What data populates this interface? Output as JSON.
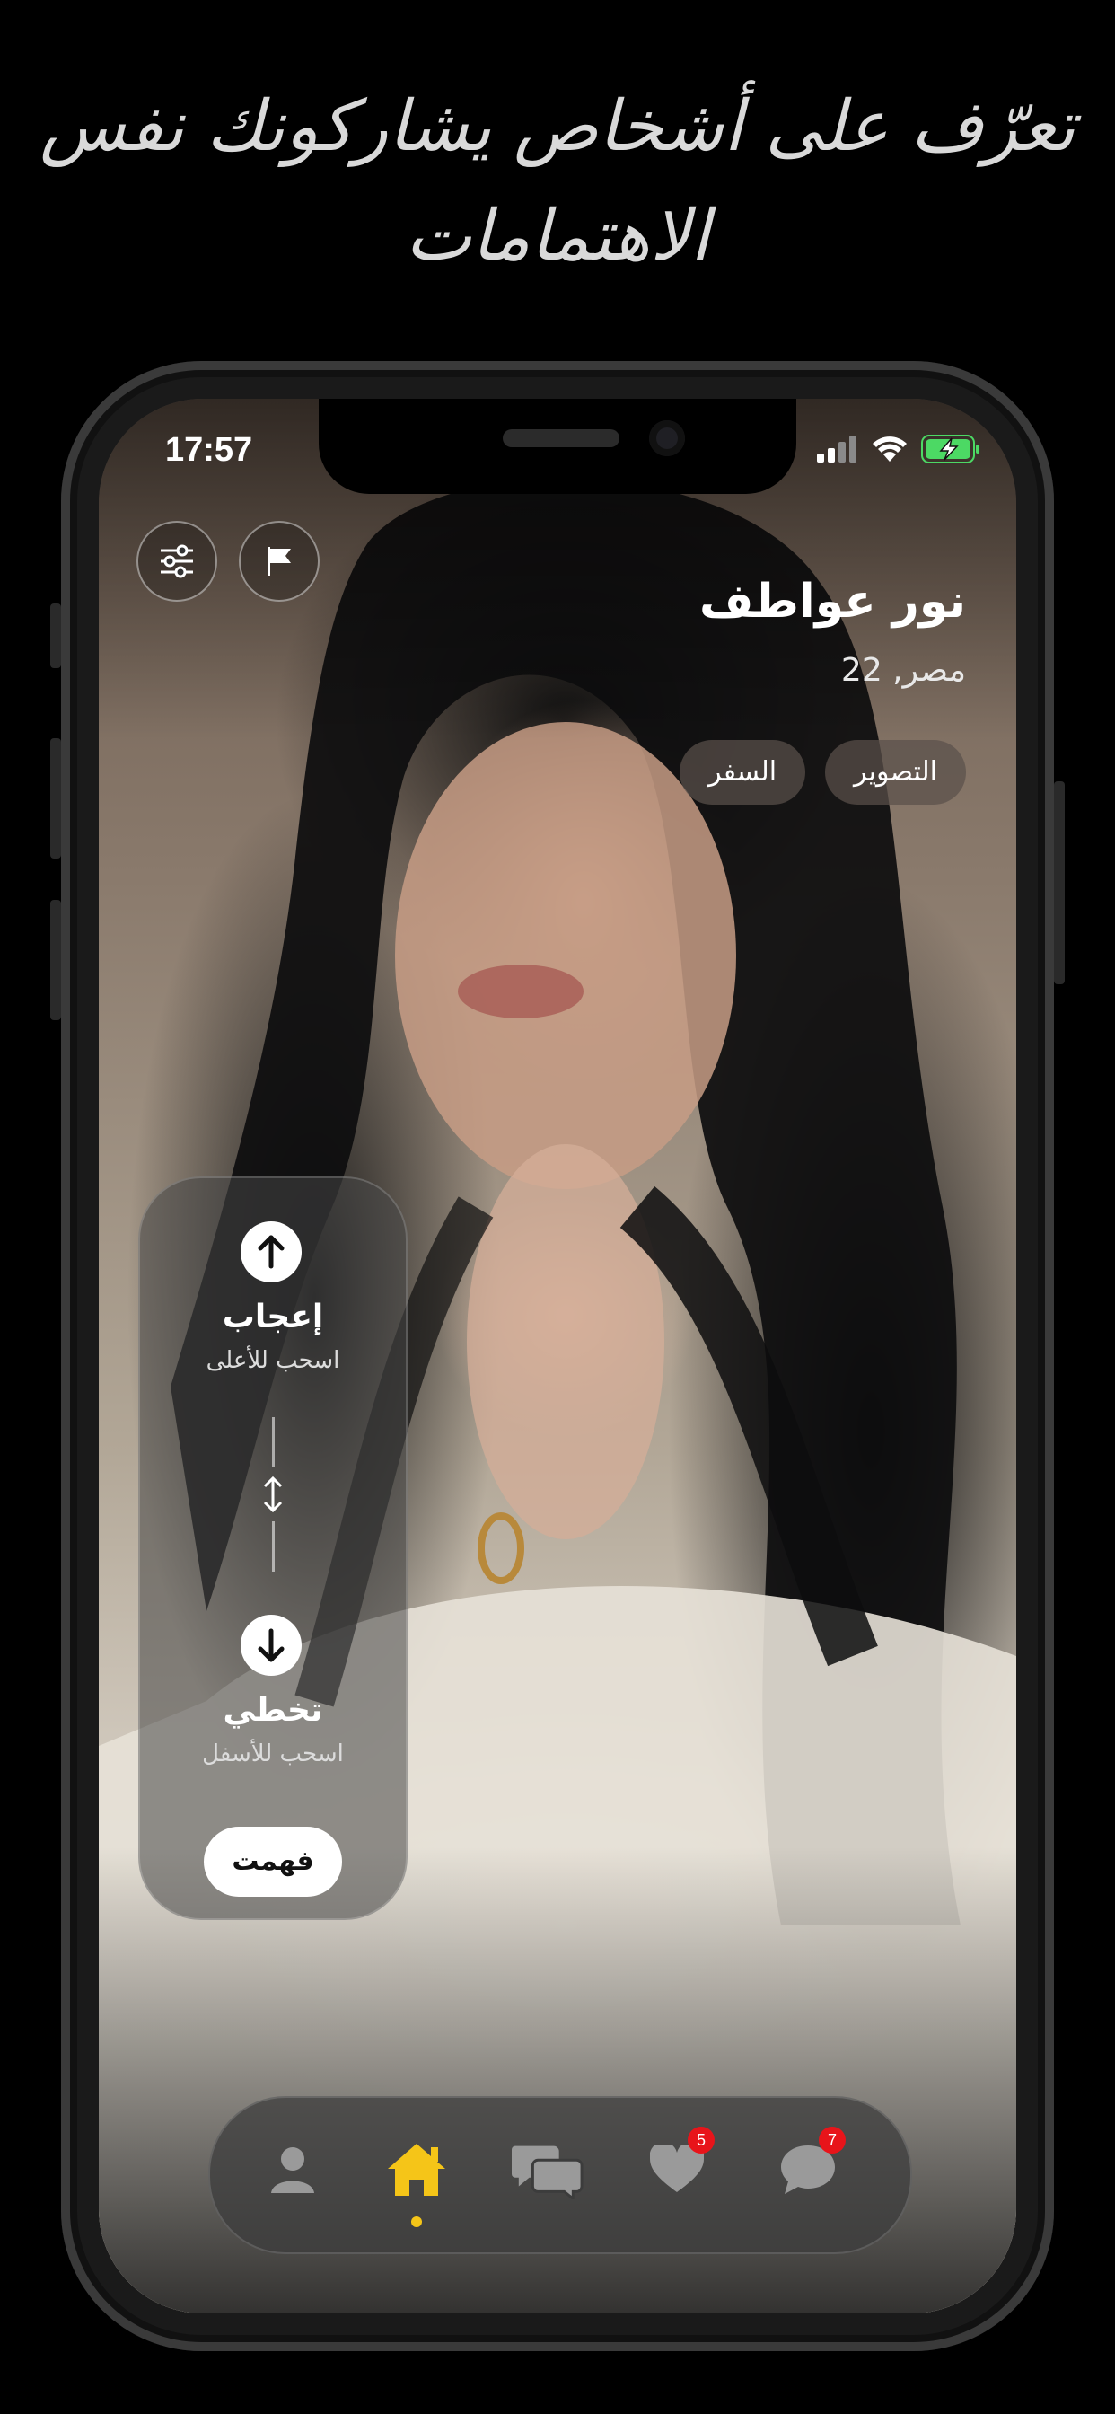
{
  "headline": {
    "line1": "تعرّف على أشخاص يشاركونك نفس",
    "line2": "الاهتمامات"
  },
  "status_bar": {
    "time": "17:57"
  },
  "profile": {
    "name": "نور عواطف",
    "meta": "22 ,مصر",
    "interests": [
      "التصوير",
      "السفر"
    ]
  },
  "tutorial": {
    "like_title": "إعجاب",
    "like_hint": "اسحب للأعلى",
    "skip_title": "تخطي",
    "skip_hint": "اسحب للأسفل",
    "confirm_label": "فهمت"
  },
  "bottom_nav": {
    "active_item": "home",
    "items": [
      {
        "id": "profile",
        "icon": "person-icon"
      },
      {
        "id": "home",
        "icon": "home-icon"
      },
      {
        "id": "chats",
        "icon": "chat-bubbles-icon"
      },
      {
        "id": "likes",
        "icon": "heart-icon",
        "badge": "5"
      },
      {
        "id": "messages",
        "icon": "message-icon",
        "badge": "7"
      }
    ]
  },
  "colors": {
    "accent": "#f5c518",
    "badge": "#e8141a",
    "battery": "#4cd964"
  }
}
